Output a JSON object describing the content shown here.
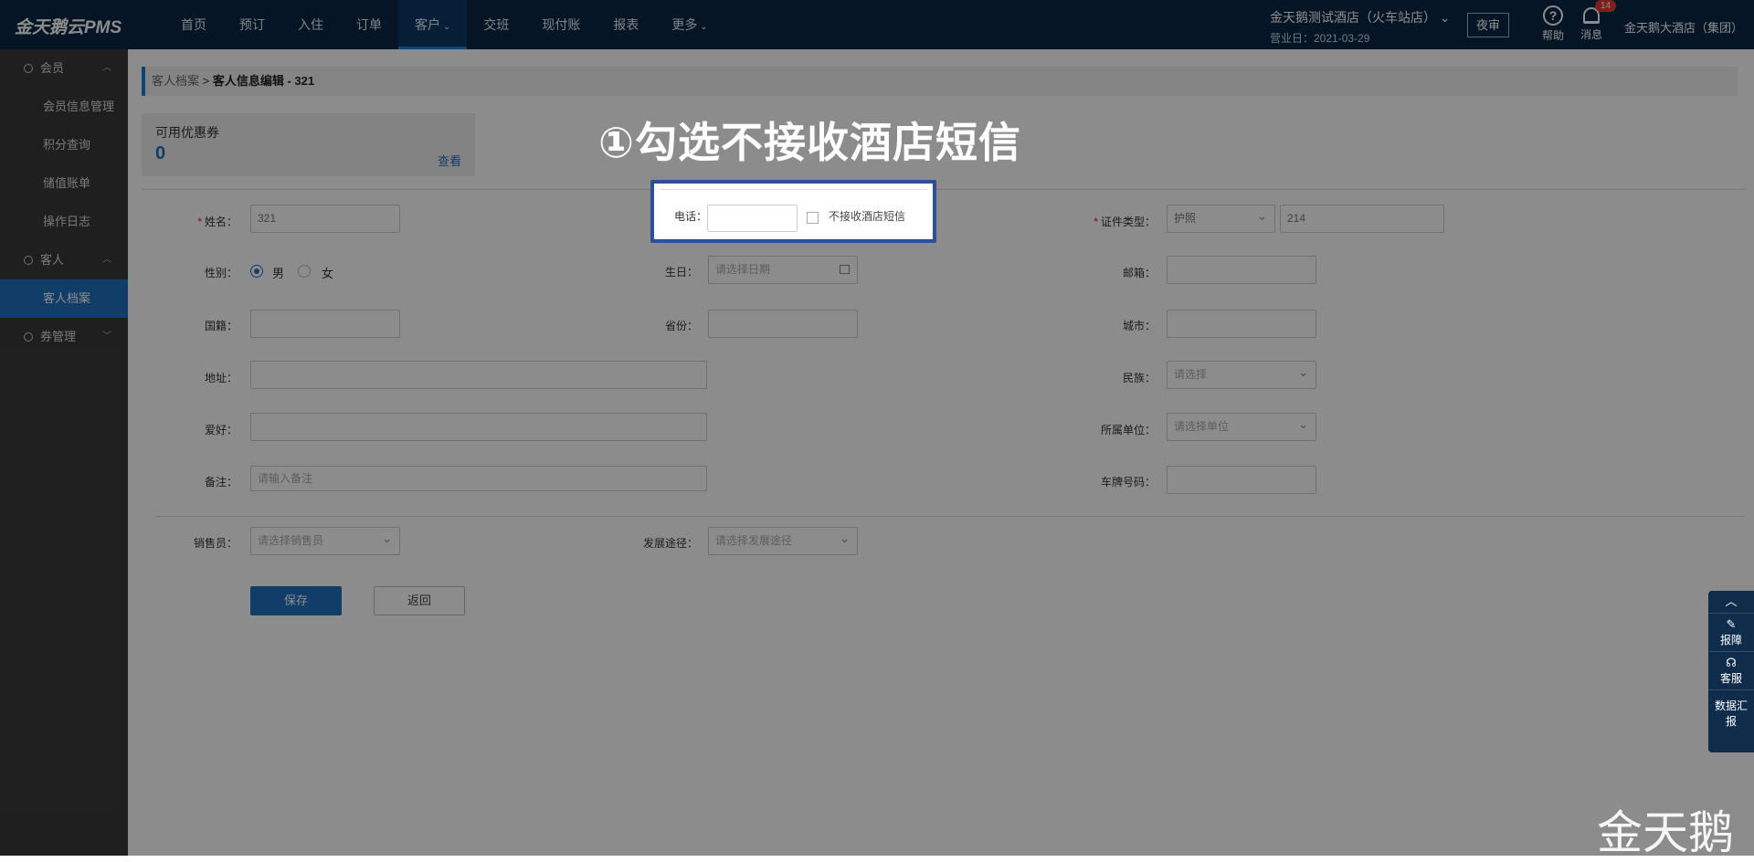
{
  "topbar": {
    "logo": "金天鹅云PMS",
    "nav": [
      "首页",
      "预订",
      "入住",
      "订单",
      "客户",
      "交班",
      "现付账",
      "报表",
      "更多"
    ],
    "hotel_name": "金天鹅测试酒店（火车站店）",
    "business_date": "营业日：2021-03-29",
    "night_audit": "夜审",
    "help": "帮助",
    "messages": "消息",
    "message_count": "14",
    "user": "金天鹅大酒店（集团）"
  },
  "sidebar": {
    "groups": [
      {
        "label": "会员",
        "items": [
          "会员信息管理",
          "积分查询",
          "储值账单",
          "操作日志"
        ]
      },
      {
        "label": "客人",
        "items": [
          "客人档案"
        ]
      },
      {
        "label": "券管理",
        "items": []
      }
    ]
  },
  "breadcrumb": {
    "parent": "客人档案",
    "sep": ">",
    "current": "客人信息编辑 -  321"
  },
  "coupon": {
    "title": "可用优惠券",
    "count": "0",
    "view": "查看"
  },
  "form": {
    "name_label": "姓名：",
    "name_value": "321",
    "phone_label": "电话：",
    "sms_label": "不接收酒店短信",
    "id_type_label": "证件类型：",
    "id_type_value": "护照",
    "id_number": "214",
    "gender_label": "性别：",
    "male": "男",
    "female": "女",
    "birthday_label": "生日：",
    "birthday_placeholder": "请选择日期",
    "zip_label": "邮箱：",
    "nationality_label": "国籍：",
    "province_label": "省份：",
    "city_label": "城市：",
    "address_label": "地址：",
    "ethnic_label": "民族：",
    "ethnic_placeholder": "请选择",
    "hobby_label": "爱好：",
    "company_label": "所属单位：",
    "company_placeholder": "请选择单位",
    "remark_label": "备注：",
    "remark_placeholder": "请输入备注",
    "plate_label": "车牌号码：",
    "sales_label": "销售员：",
    "sales_placeholder": "请选择销售员",
    "channel_label": "发展途径：",
    "channel_placeholder": "请选择发展途径",
    "save": "保存",
    "back": "返回"
  },
  "callout": "①勾选不接收酒店短信",
  "float_panel": [
    "报障",
    "客服",
    "数据汇报"
  ],
  "watermark": "金天鹅"
}
